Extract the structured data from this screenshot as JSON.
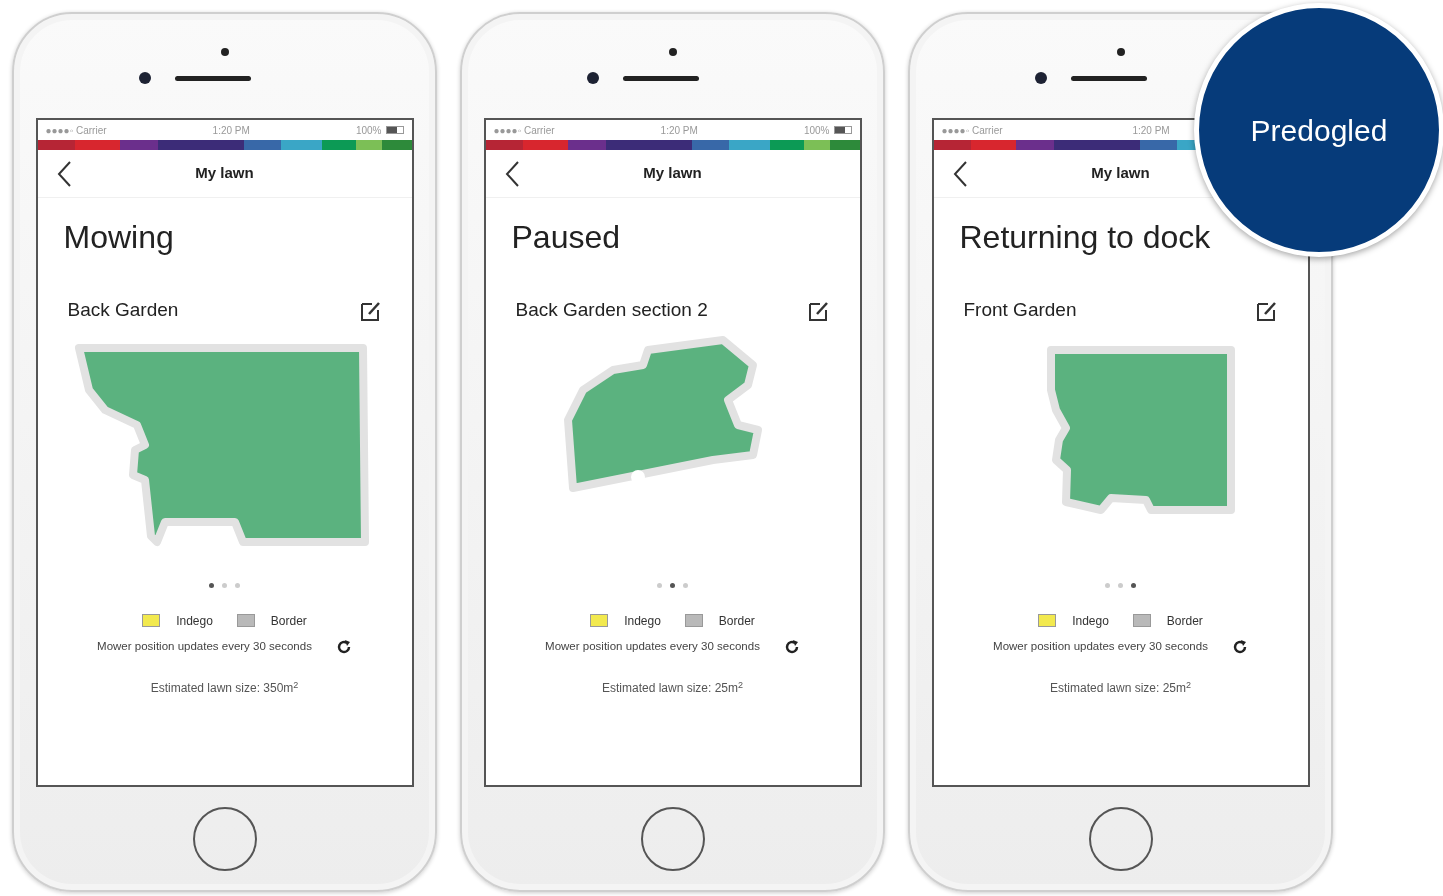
{
  "phones": [
    {
      "status_bar": {
        "carrier": "●●●●◦ Carrier",
        "time": "1:20 PM",
        "battery": "100%"
      },
      "nav_title": "My lawn",
      "status": "Mowing",
      "garden_name": "Back Garden",
      "pages": [
        {
          "selected": true
        },
        {
          "selected": false
        },
        {
          "selected": false
        }
      ],
      "legend": [
        {
          "label": "Indego",
          "color": "#f2e94e"
        },
        {
          "label": "Border",
          "color": "#b9b9b9"
        }
      ],
      "update_note": "Mower position updates every 30 seconds",
      "lawn_size": "Estimated lawn size: 350m$^{2}$"
    },
    {
      "status_bar": {
        "carrier": "●●●●◦ Carrier",
        "time": "1:20 PM",
        "battery": "100%"
      },
      "nav_title": "My lawn",
      "status": "Paused",
      "garden_name": "Back Garden section 2",
      "pages": [
        {
          "selected": false
        },
        {
          "selected": true
        },
        {
          "selected": false
        }
      ],
      "legend": [
        {
          "label": "Indego",
          "color": "#f2e94e"
        },
        {
          "label": "Border",
          "color": "#b9b9b9"
        }
      ],
      "update_note": "Mower position updates every 30 seconds",
      "lawn_size": "Estimated lawn size: 25m$^{2}$"
    },
    {
      "status_bar": {
        "carrier": "●●●●◦ Carrier",
        "time": "1:20 PM"
      },
      "nav_title": "My lawn",
      "status": "Returning to dock",
      "garden_name": "Front Garden",
      "pages": [
        {
          "selected": false
        },
        {
          "selected": false
        },
        {
          "selected": true
        }
      ],
      "legend": [
        {
          "label": "Indego",
          "color": "#f2e94e"
        },
        {
          "label": "Border",
          "color": "#b9b9b9"
        }
      ],
      "update_note": "Mower position updates every 30 seconds",
      "lawn_size": "Estimated lawn size: 25m$^{2}$"
    }
  ],
  "badge": {
    "text": "Predogled"
  }
}
